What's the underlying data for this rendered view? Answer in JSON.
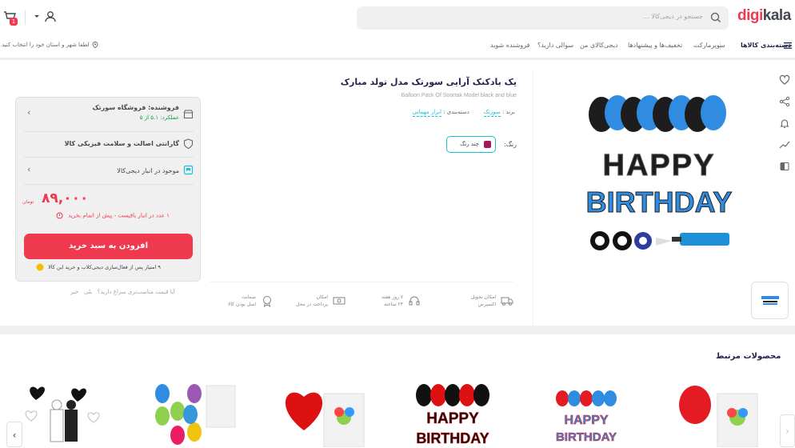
{
  "header": {
    "logo_part1": "digi",
    "logo_part2": "kala",
    "search_placeholder": "جستجو در دیجی‌کالا ...",
    "cart_count": "1"
  },
  "nav": {
    "categories": "دسته‌بندی کالاها",
    "items": [
      "سوپرمارکت",
      "تخفیف‌ها و پیشنهادها",
      "دیجی‌کالای من",
      "سوالی دارید؟",
      "فروشنده شوید"
    ],
    "location": "لطفا شهر و استان خود را انتخاب کنید"
  },
  "product": {
    "title": "یک بادکنک آرایی سورتک مدل تولد مبارک",
    "title_en": "Balloon Pack Of Soortak Model black and blue",
    "brand_label": "برند",
    "brand_value": "سورتک",
    "category_label": "دسته‌بندی",
    "category_value": "ابزار مهمانی",
    "color_label": "رنگ:",
    "color_value": "چند رنگ",
    "color_hex": "#a4185b",
    "image_text_1": "HAPPY",
    "image_text_2": "BIRTHDAY"
  },
  "buybox": {
    "seller_label": "فروشنده: فروشگاه سورتک",
    "seller_rating": "عملکرد: ۵.۱ از ۵",
    "warranty": "گارانتی اصالت و سلامت فیزیکی کالا",
    "warehouse": "موجود در انبار دیجی‌کالا",
    "price": "۸۹,۰۰۰",
    "currency": "تومان",
    "stock_note": "۱ عدد در انبار باقیست - پیش از اتمام بخرید",
    "add_to_cart": "افزودن به سبد خرید",
    "points_note": "۹ امتیاز پس از فعال‌سازی دیجی‌کلاب و خرید این کالا",
    "price_suggest": "آیا قیمت مناسب‌تری سراغ دارید؟",
    "yes": "بلی",
    "no": "خیر"
  },
  "features": [
    {
      "line1": "امکان تحویل",
      "line2": "اکسپرس"
    },
    {
      "line1": "۷ روز هفته",
      "line2": "۲۴ ساعته"
    },
    {
      "line1": "امکان",
      "line2": "پرداخت در محل"
    },
    {
      "line1": "ضمانت",
      "line2": "اصل بودن کالا"
    }
  ],
  "related": {
    "title": "محصولات مرتبط",
    "arrow_left": "‹",
    "arrow_right": "›"
  },
  "colors": {
    "brand_red": "#ef394e",
    "accent_cyan": "#19bfd3",
    "text_dark": "#23254e"
  }
}
